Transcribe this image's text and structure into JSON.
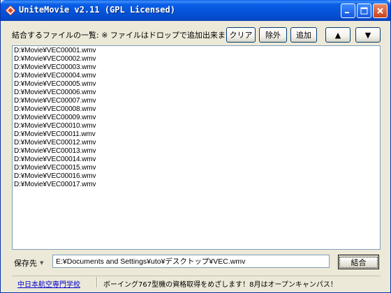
{
  "window": {
    "title": "UniteMovie v2.11 (GPL Licensed)"
  },
  "toolbar": {
    "list_label": "結合するファイルの一覧: ※ ファイルはドロップで追加出来ます。",
    "clear_label": "クリア",
    "remove_label": "除外",
    "add_label": "追加",
    "up_label": "▲",
    "down_label": "▼"
  },
  "file_list": [
    "D:¥Movie¥VEC00001.wmv",
    "D:¥Movie¥VEC00002.wmv",
    "D:¥Movie¥VEC00003.wmv",
    "D:¥Movie¥VEC00004.wmv",
    "D:¥Movie¥VEC00005.wmv",
    "D:¥Movie¥VEC00006.wmv",
    "D:¥Movie¥VEC00007.wmv",
    "D:¥Movie¥VEC00008.wmv",
    "D:¥Movie¥VEC00009.wmv",
    "D:¥Movie¥VEC00010.wmv",
    "D:¥Movie¥VEC00011.wmv",
    "D:¥Movie¥VEC00012.wmv",
    "D:¥Movie¥VEC00013.wmv",
    "D:¥Movie¥VEC00014.wmv",
    "D:¥Movie¥VEC00015.wmv",
    "D:¥Movie¥VEC00016.wmv",
    "D:¥Movie¥VEC00017.wmv"
  ],
  "output": {
    "save_label": "保存先",
    "save_path": "E:¥Documents and Settings¥uto¥デスクトップ¥VEC.wmv",
    "combine_label": "結合"
  },
  "status": {
    "link_text": "中日本航空専門学校",
    "message": "ボーイング767型機の資格取得をめざします！8月はオープンキャンパス！"
  },
  "colors": {
    "titlebar": "#0a5fe8",
    "window_bg": "#ece9d8",
    "link": "#0000cc"
  },
  "icons": {
    "app": "diamond-icon",
    "minimize": "minimize-icon",
    "maximize": "maximize-icon",
    "close": "close-icon"
  }
}
